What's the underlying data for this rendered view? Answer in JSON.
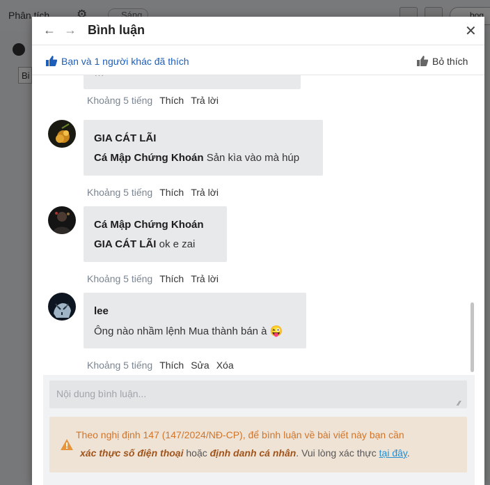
{
  "background": {
    "tab_label": "Phân tích",
    "search_hint": "bog",
    "chip_label": "Sáng",
    "left_label": "Bi"
  },
  "modal": {
    "title": "Bình luận",
    "likes_text": "Bạn và 1 người khác đã thích",
    "unlike_label": "Bỏ thích"
  },
  "comments": [
    {
      "body": "…",
      "time": "Khoảng 5 tiếng",
      "actions": [
        "Thích",
        "Trả lời"
      ]
    },
    {
      "author": "GIA CÁT LÃI",
      "mention": "Cá Mập Chứng Khoán",
      "body": " Sản kìa vào mà húp",
      "time": "Khoảng 5 tiếng",
      "actions": [
        "Thích",
        "Trả lời"
      ],
      "avatar": "avatar-gold"
    },
    {
      "author": "Cá Mập Chứng Khoán",
      "mention": "GIA CÁT LÃI",
      "body": " ok e zai",
      "time": "Khoảng 5 tiếng",
      "actions": [
        "Thích",
        "Trả lời"
      ],
      "avatar": "avatar-dark"
    },
    {
      "author": "lee",
      "body": "Ông nào nhầm lệnh Mua thành bán à",
      "emoji": "😜",
      "time": "Khoảng 5 tiếng",
      "actions": [
        "Thích",
        "Sửa",
        "Xóa"
      ],
      "avatar": "avatar-tiger"
    }
  ],
  "composer": {
    "placeholder": "Nội dung bình luận...",
    "notice": {
      "line1": "Theo nghị định 147 (147/2024/NĐ-CP), để bình luận về bài viết này bạn cần",
      "em1": "xác thực số điện thoại",
      "or": " hoặc ",
      "em2": "định danh cá nhân",
      "tail": ". Vui lòng xác thực ",
      "link": "tại đây",
      "end": "."
    }
  },
  "colors": {
    "link_blue": "#1d5fb8",
    "bubble_bg": "#e8e9eb",
    "notice_bg": "#efe3d6",
    "notice_orange": "#d0752a"
  }
}
